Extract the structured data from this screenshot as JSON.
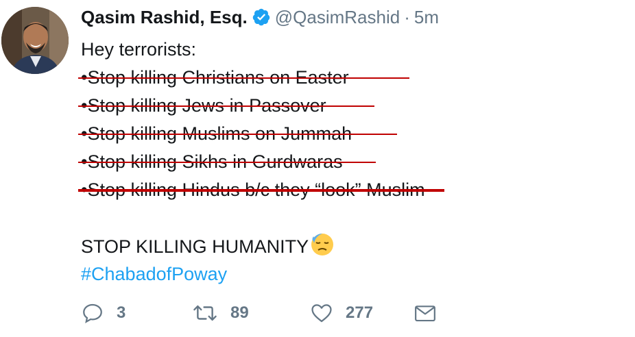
{
  "tweet": {
    "author_name": "Qasim Rashid, Esq.",
    "handle": "@QasimRashid",
    "separator": "·",
    "time": "5m",
    "lines": [
      "Hey terrorists:",
      "•Stop killing Christians",
      "on Easter",
      "•Stop killing Jews",
      "in Passover",
      "•Stop killing Muslims",
      "on Jummah",
      "•Stop killing Sikhs",
      "in Gurdwaras",
      "•Stop killing Hindus",
      "b/c they “look” Muslim"
    ],
    "closing": "STOP KILLING HUMANITY",
    "hashtag": "#ChabadofPoway",
    "emoji_name": "downcast-face-with-sweat-emoji"
  },
  "actions": {
    "replies": "3",
    "retweets": "89",
    "likes": "277"
  },
  "colors": {
    "link": "#1da1f2",
    "muted": "#657786",
    "strike": "#c00000",
    "verified": "#1da1f2"
  }
}
